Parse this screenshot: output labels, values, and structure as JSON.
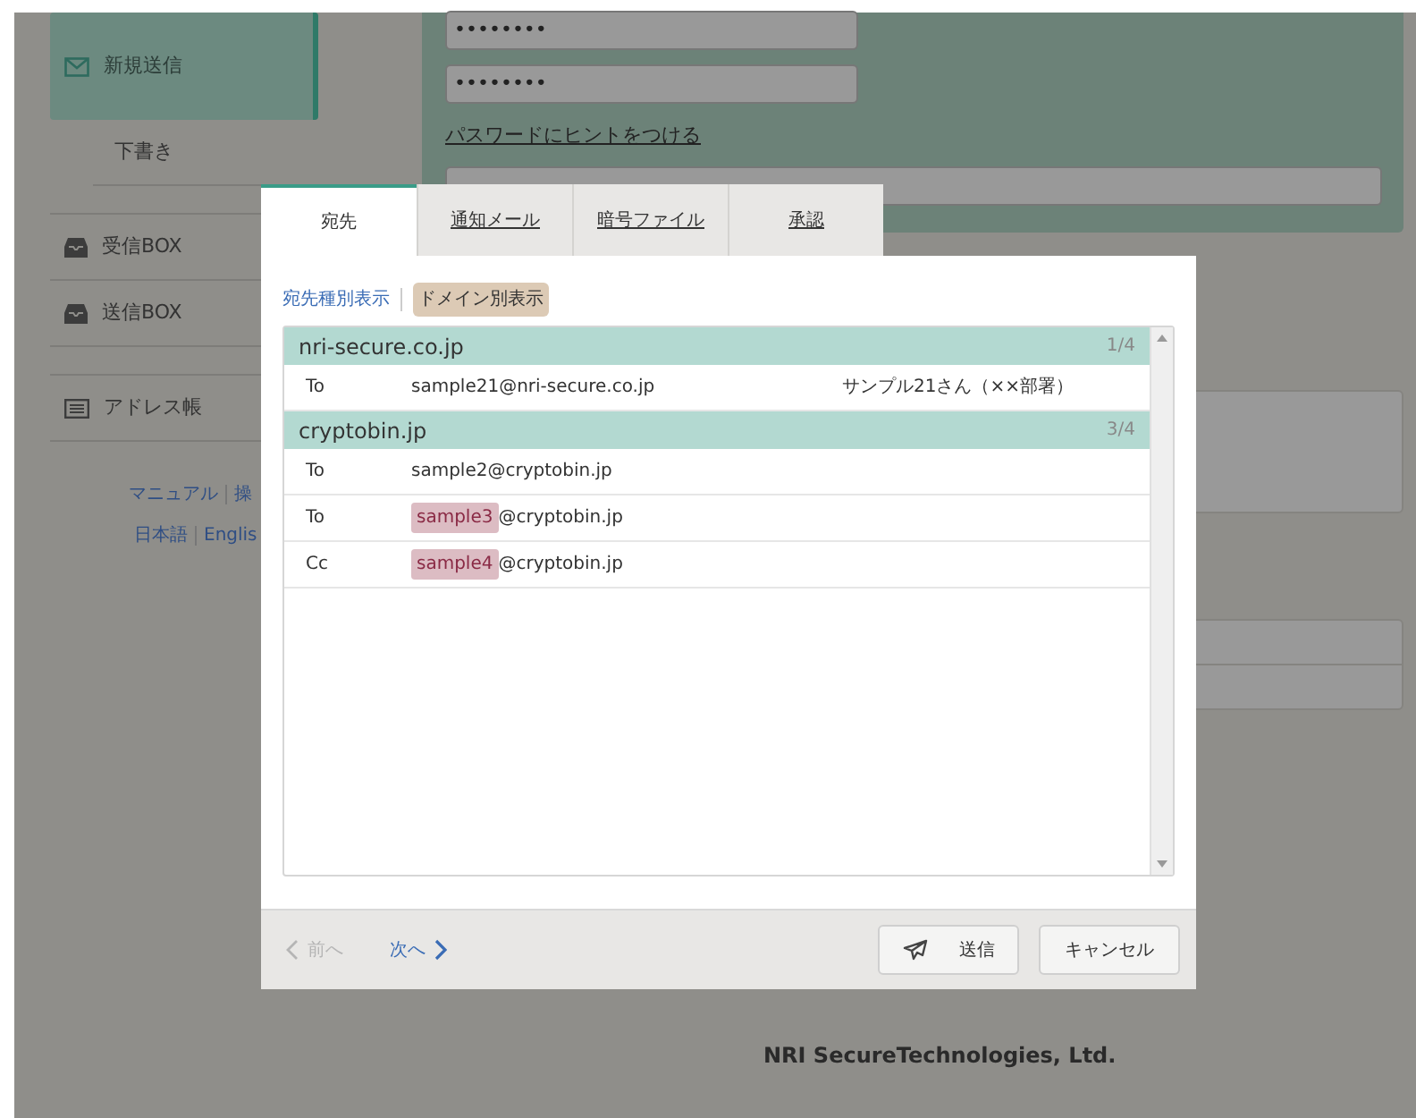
{
  "sidebar": {
    "items": [
      {
        "label": "新規送信",
        "kind": "mail",
        "selected": true
      },
      {
        "label": "下書き",
        "kind": "sub",
        "selected": false
      },
      {
        "label": "受信BOX",
        "kind": "tray",
        "selected": false
      },
      {
        "label": "送信BOX",
        "kind": "tray",
        "selected": false
      },
      {
        "label": "アドレス帳",
        "kind": "book",
        "selected": false
      }
    ],
    "links": [
      [
        "マニュアル",
        "操"
      ],
      [
        "日本語",
        "Englis"
      ]
    ]
  },
  "form": {
    "password": "••••••••",
    "password_confirm": "••••••••",
    "hint_link": "パスワードにヒントをつける"
  },
  "footer": {
    "company": "NRI SecureTechnologies, Ltd."
  },
  "dialog": {
    "tabs": [
      {
        "label": "宛先",
        "selected": true
      },
      {
        "label": "通知メール",
        "selected": false
      },
      {
        "label": "暗号ファイル",
        "selected": false
      },
      {
        "label": "承認",
        "selected": false
      }
    ],
    "views": [
      {
        "label": "宛先種別表示",
        "selected": false
      },
      {
        "label": "ドメイン別表示",
        "selected": true
      }
    ],
    "groups": [
      {
        "domain": "nri-secure.co.jp",
        "count": "1/4",
        "rows": [
          {
            "type": "To",
            "local": "sample21",
            "rest": "@nri-secure.co.jp",
            "highlighted": false,
            "name": "サンプル21さん（××部署）"
          }
        ]
      },
      {
        "domain": "cryptobin.jp",
        "count": "3/4",
        "rows": [
          {
            "type": "To",
            "local": "sample2",
            "rest": "@cryptobin.jp",
            "highlighted": false
          },
          {
            "type": "To",
            "local": "sample3",
            "rest": "@cryptobin.jp",
            "highlighted": true
          },
          {
            "type": "Cc",
            "local": "sample4",
            "rest": "@cryptobin.jp",
            "highlighted": true
          }
        ]
      }
    ],
    "prev": {
      "label": "前へ",
      "disabled": true
    },
    "next": {
      "label": "次へ",
      "disabled": false
    },
    "buttons": {
      "send": "送信",
      "cancel": "キャンセル"
    }
  }
}
